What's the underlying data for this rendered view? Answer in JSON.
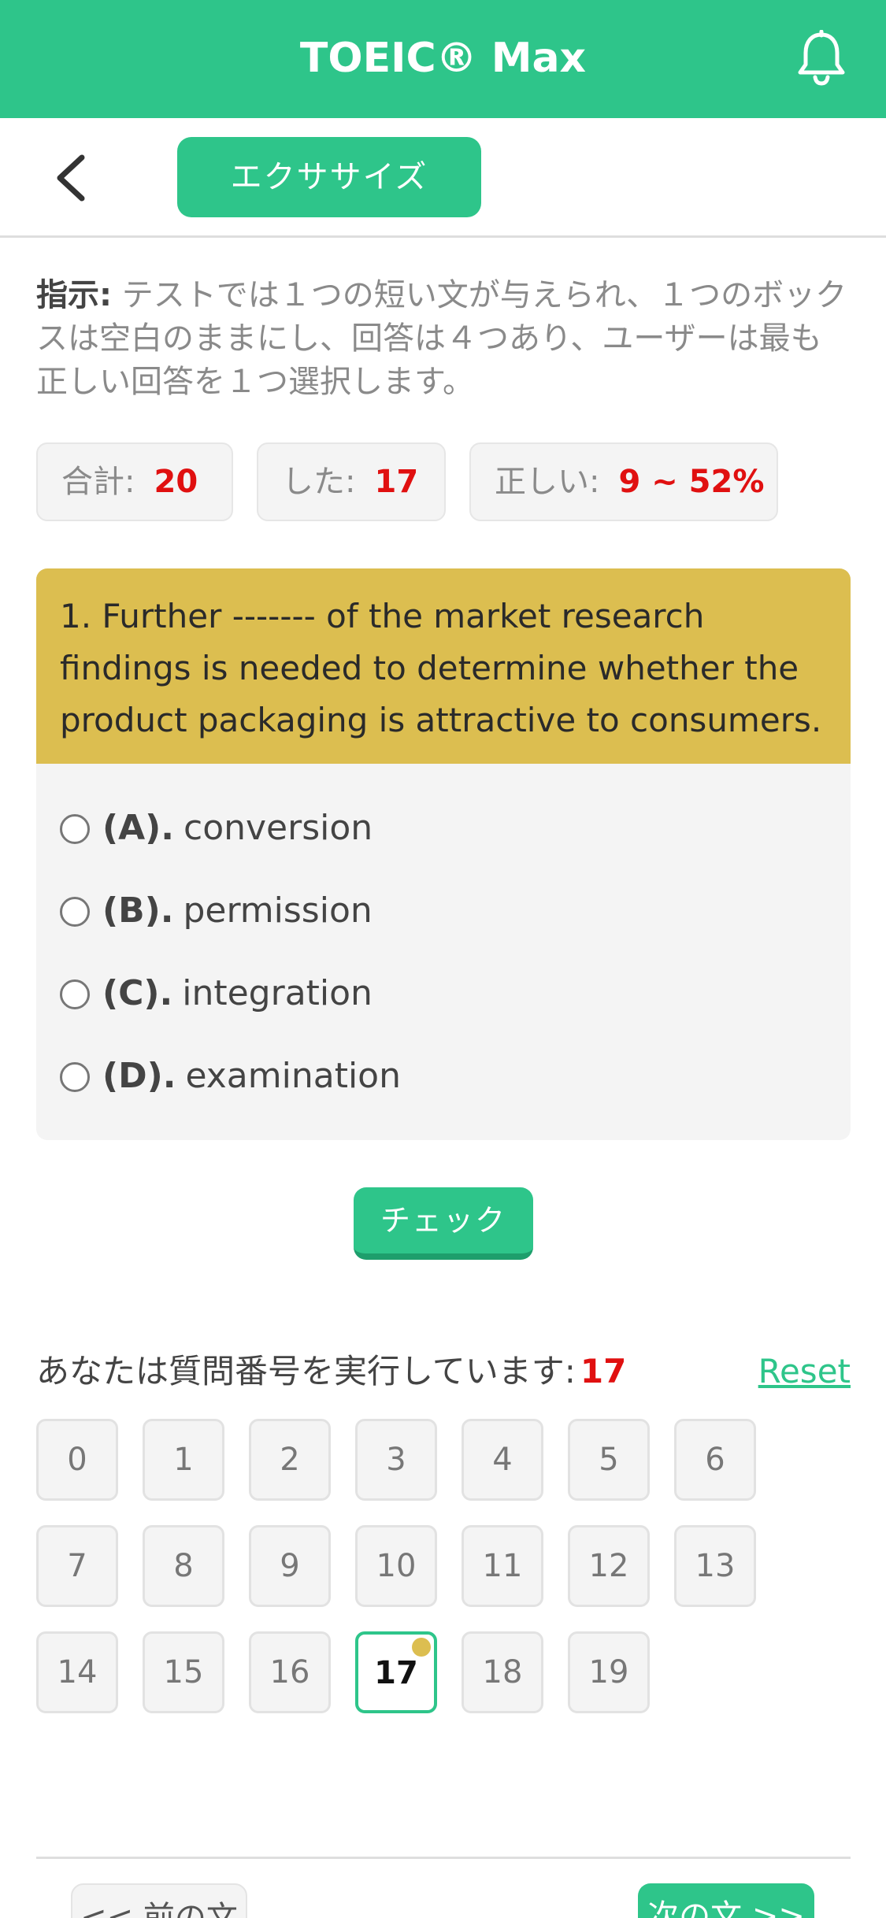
{
  "app": {
    "title": "TOEIC® Max"
  },
  "subbar": {
    "tab_label": "エクササイズ"
  },
  "instructions": {
    "label": "指示:",
    "text": " テストでは１つの短い文が与えられ、１つのボックスは空白のままにし、回答は４つあり、ユーザーは最も正しい回答を１つ選択します。"
  },
  "stats": [
    {
      "label": "合計:",
      "value": "20"
    },
    {
      "label": "した:",
      "value": "17"
    },
    {
      "label": "正しい:",
      "value": "9 ~ 52%"
    }
  ],
  "question": {
    "text": "1. Further ------- of the market research findings is needed to determine whether the product packaging is attractive to consumers.",
    "options": [
      {
        "letter": "(A).",
        "text": "conversion"
      },
      {
        "letter": "(B).",
        "text": "permission"
      },
      {
        "letter": "(C).",
        "text": "integration"
      },
      {
        "letter": "(D).",
        "text": "examination"
      }
    ]
  },
  "check_label": "チェック",
  "progress": {
    "label": "あなたは質問番号を実行しています:",
    "current": "17",
    "reset_label": "Reset"
  },
  "question_numbers": [
    "0",
    "1",
    "2",
    "3",
    "4",
    "5",
    "6",
    "7",
    "8",
    "9",
    "10",
    "11",
    "12",
    "13",
    "14",
    "15",
    "16",
    "17",
    "18",
    "19"
  ],
  "nav": {
    "prev_label": "<< 前の文",
    "next_label": "次の文 >>"
  },
  "colors": {
    "primary": "#2ec58a",
    "question_bg": "#dcbe50",
    "accent_red": "#e01010"
  }
}
